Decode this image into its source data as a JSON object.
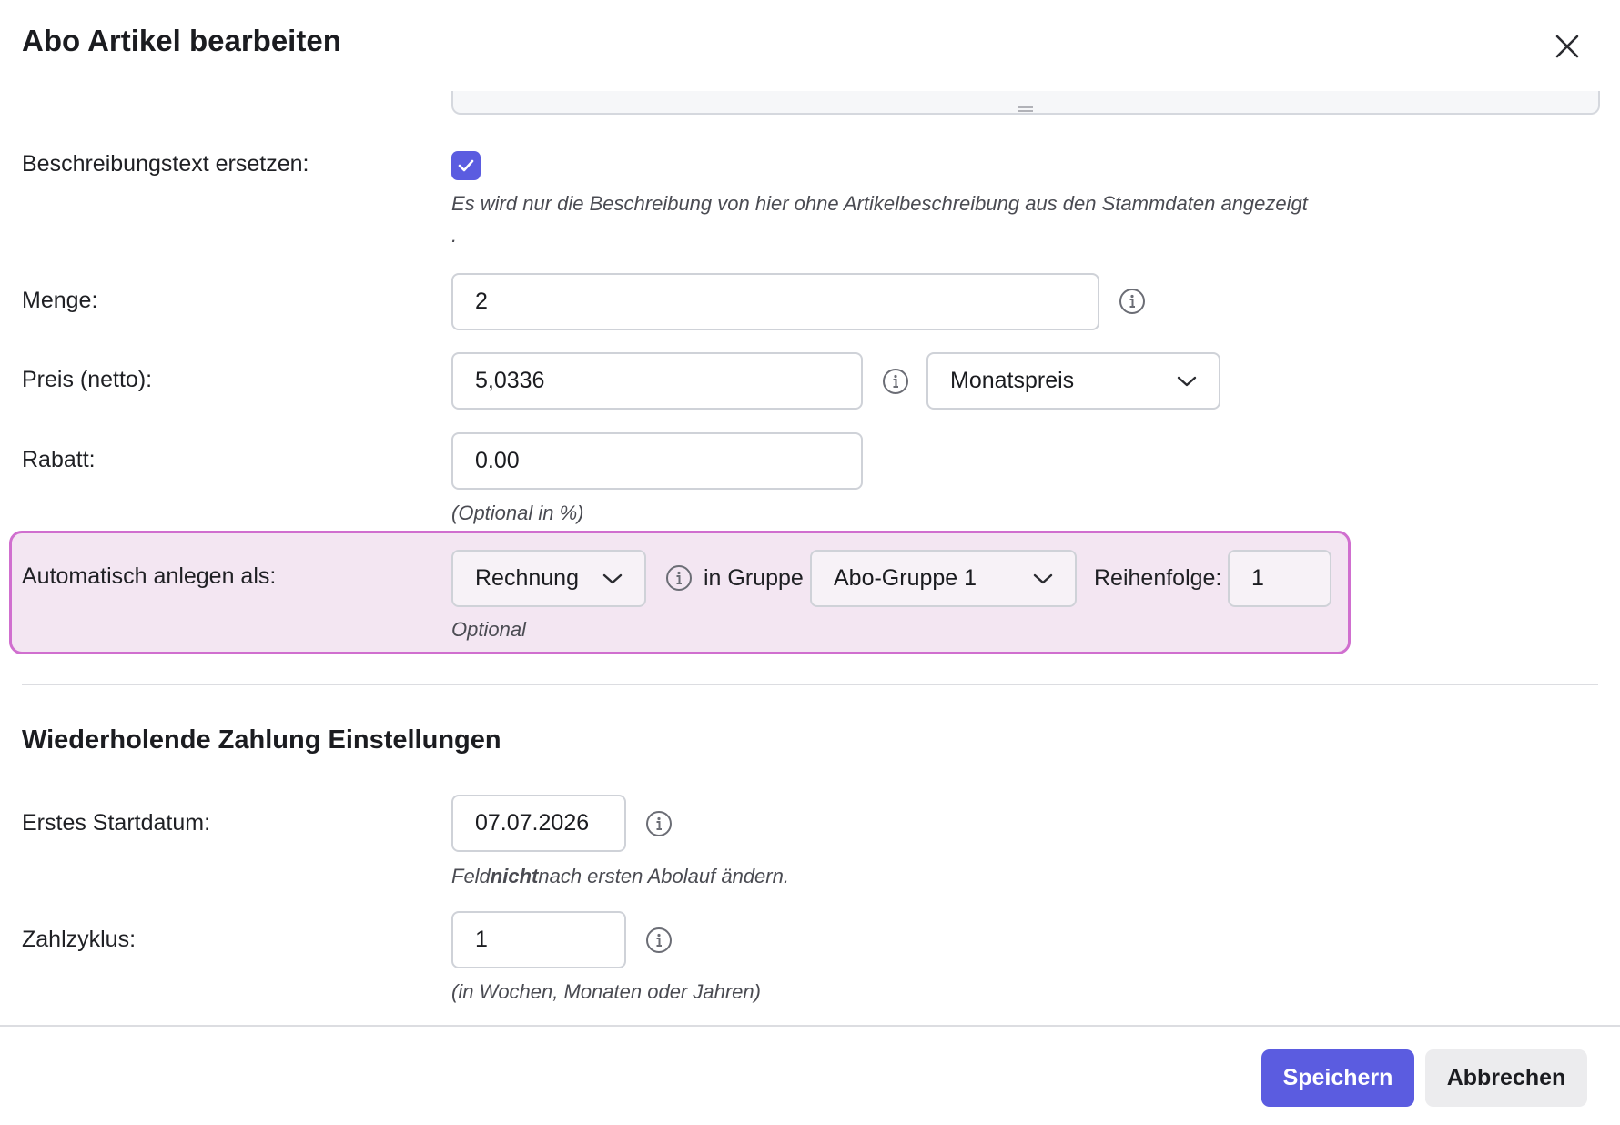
{
  "dialog": {
    "title": "Abo Artikel bearbeiten"
  },
  "description_replace": {
    "label": "Beschreibungstext ersetzen:",
    "checked": true,
    "hint": "Es wird nur die Beschreibung von hier ohne Artikelbeschreibung aus den Stammdaten angezeigt",
    "hint_dot": "."
  },
  "quantity": {
    "label": "Menge:",
    "value": "2"
  },
  "price": {
    "label": "Preis (netto):",
    "value": "5,0336",
    "period_selected": "Monatspreis"
  },
  "discount": {
    "label": "Rabatt:",
    "value": "0.00",
    "hint": "(Optional in %)"
  },
  "auto_create": {
    "label": "Automatisch anlegen als:",
    "type_selected": "Rechnung",
    "group_label": "in Gruppe",
    "group_selected": "Abo-Gruppe 1",
    "order_label": "Reihenfolge:",
    "order_value": "1",
    "hint": "Optional"
  },
  "recurring": {
    "section_title": "Wiederholende Zahlung Einstellungen",
    "start_date": {
      "label": "Erstes Startdatum:",
      "value": "07.07.2026",
      "hint_prefix": "Feld",
      "hint_bold": "nicht",
      "hint_suffix": "nach ersten Abolauf ändern."
    },
    "cycle": {
      "label": "Zahlzyklus:",
      "value": "1",
      "hint": "(in Wochen, Monaten oder Jahren)"
    }
  },
  "footer": {
    "save_label": "Speichern",
    "cancel_label": "Abbrechen"
  },
  "colors": {
    "accent": "#5b5ce0",
    "highlight_border": "#d06fcf",
    "highlight_bg": "#f3e6f2"
  }
}
